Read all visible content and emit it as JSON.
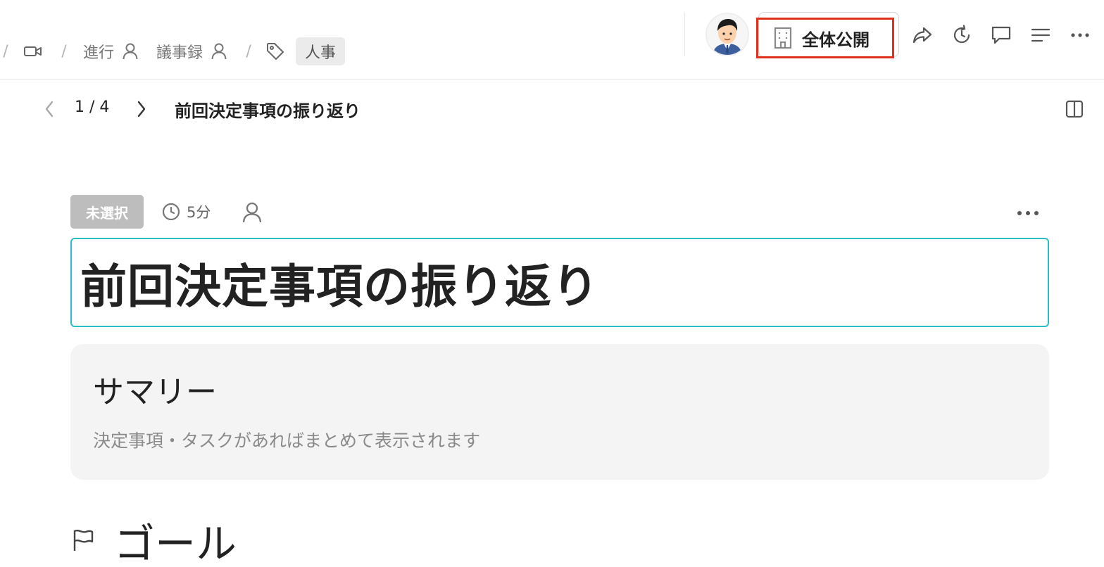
{
  "breadcrumb": {
    "separator": "/",
    "items": [
      {
        "label": "進行",
        "icon": "person-icon"
      },
      {
        "label": "議事録",
        "icon": "person-icon"
      }
    ],
    "tag": "人事"
  },
  "header": {
    "visibility_label": "全体公開",
    "visibility_icon": "building-icon",
    "highlight_color": "#e0311c"
  },
  "pager": {
    "count": "1 / 4",
    "title": "前回決定事項の振り返り"
  },
  "agenda": {
    "status": "未選択",
    "duration": "5分",
    "title": "前回決定事項の振り返り",
    "accent_color": "#28c0c4"
  },
  "summary": {
    "heading": "サマリー",
    "description": "決定事項・タスクがあればまとめて表示されます"
  },
  "goal": {
    "heading": "ゴール"
  }
}
